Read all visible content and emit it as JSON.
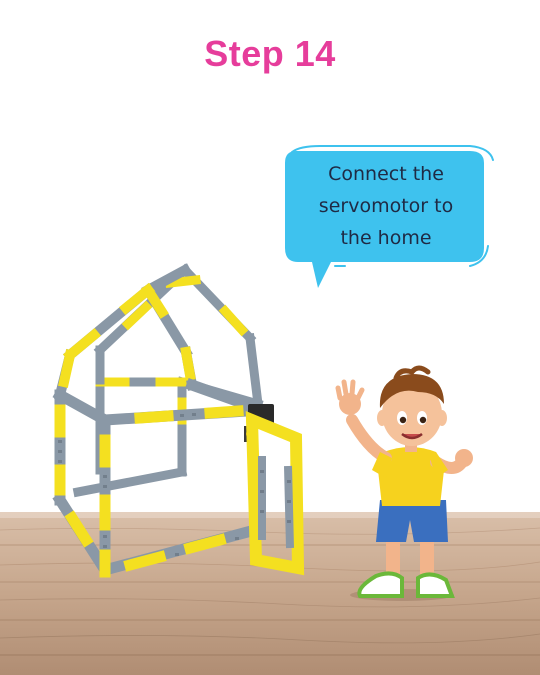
{
  "step": {
    "title": "Step 14"
  },
  "speech_bubble": {
    "lines": [
      "Connect the",
      "servomotor to",
      "the home"
    ]
  },
  "colors": {
    "title": "#e63d9b",
    "bubble": "#3ec2ee",
    "frame_gray": "#8a98a6",
    "frame_yellow": "#f4e020",
    "floor": "#c9a88e"
  },
  "illustration": {
    "model": "house-frame-with-servomotor-door",
    "character": "waving-boy"
  }
}
